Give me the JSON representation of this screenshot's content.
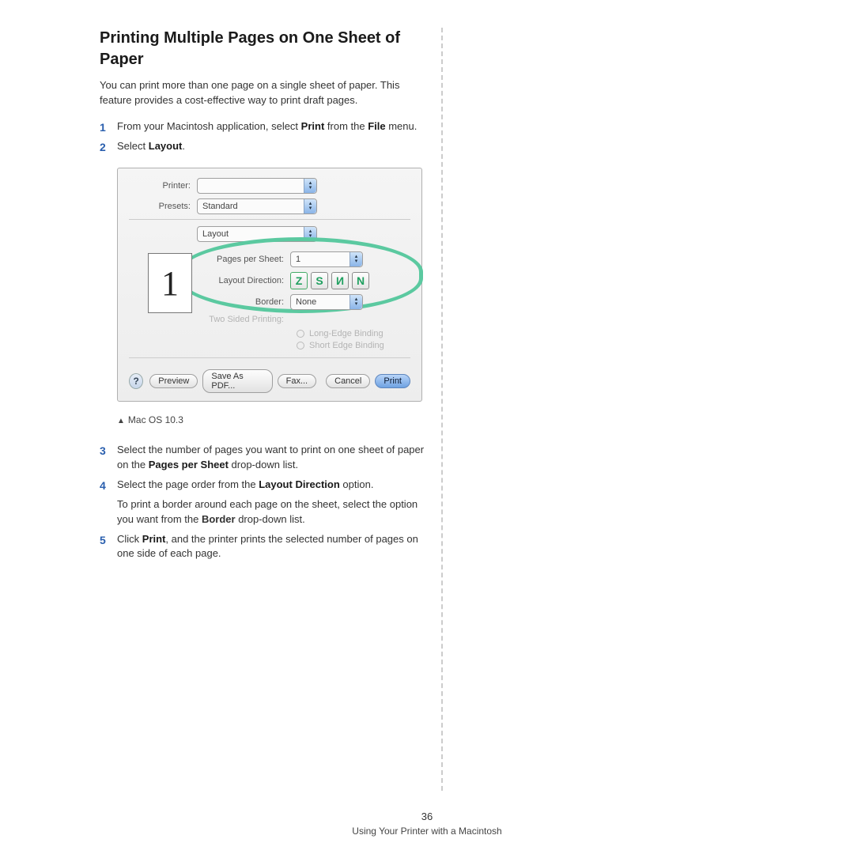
{
  "heading": "Printing Multiple Pages on One Sheet of Paper",
  "intro": "You can print more than one page on a single sheet of paper. This feature provides a cost-effective way to print draft pages.",
  "steps": {
    "1": {
      "pre": "From your Macintosh application, select ",
      "b": "Print",
      "post": " from the ",
      "b2": "File",
      "post2": " menu."
    },
    "2": {
      "pre": "Select ",
      "b": "Layout",
      "post": "."
    },
    "3": {
      "pre": "Select the number of pages you want to print on one sheet of paper on the ",
      "b": "Pages per Sheet",
      "post": " drop-down list."
    },
    "4": {
      "pre": "Select the page order from the ",
      "b": "Layout Direction",
      "post": " option.",
      "sub_pre": "To print a border around each page on the sheet, select the option you want from the ",
      "sub_b": "Border",
      "sub_post": " drop-down list."
    },
    "5": {
      "pre": "Click ",
      "b": "Print",
      "post": ", and the printer prints the selected number of pages on one side of each page."
    }
  },
  "dialog": {
    "printer_label": "Printer:",
    "printer_value": "",
    "presets_label": "Presets:",
    "presets_value": "Standard",
    "section_value": "Layout",
    "pps_label": "Pages per Sheet:",
    "pps_value": "1",
    "dir_label": "Layout Direction:",
    "border_label": "Border:",
    "border_value": "None",
    "twosided_label": "Two Sided Printing:",
    "radio_long": "Long-Edge Binding",
    "radio_short": "Short Edge Binding",
    "preview_number": "1",
    "buttons": {
      "help": "?",
      "preview": "Preview",
      "savepdf": "Save As PDF...",
      "fax": "Fax...",
      "cancel": "Cancel",
      "print": "Print"
    }
  },
  "caption": "Mac OS 10.3",
  "footer_page": "36",
  "footer_text": "Using Your Printer with a Macintosh"
}
